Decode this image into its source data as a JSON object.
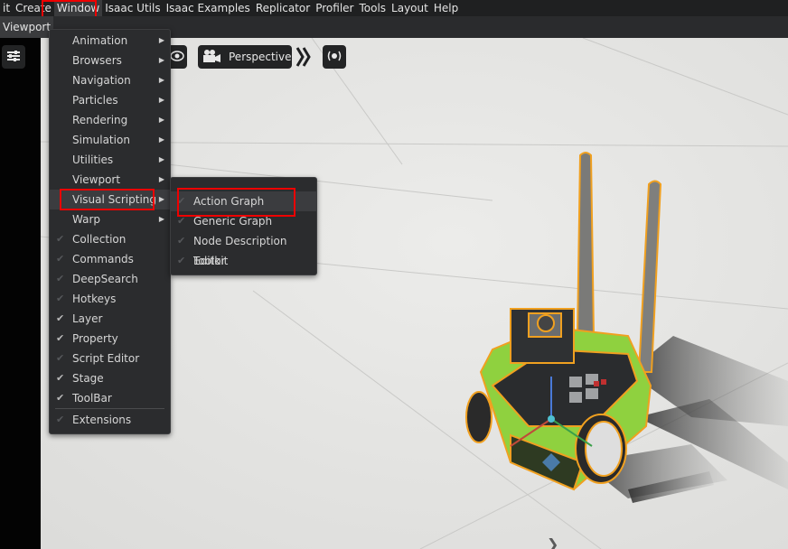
{
  "menubar": {
    "items": [
      "it",
      "Create",
      "Window",
      "Isaac Utils",
      "Isaac Examples",
      "Replicator",
      "Profiler",
      "Tools",
      "Layout",
      "Help"
    ]
  },
  "tabs": {
    "viewport": "Viewport"
  },
  "viewport_toolbar": {
    "settings_icon": "sliders-icon",
    "camera_icon": "camera-icon",
    "camera_label": "Perspective",
    "eye_icon": "eye-icon",
    "render_icon": "broadcast-icon",
    "expand_icon": "double-chevron-icon"
  },
  "window_menu": {
    "items": [
      {
        "label": "Animation",
        "submenu": true
      },
      {
        "label": "Browsers",
        "submenu": true
      },
      {
        "label": "Navigation",
        "submenu": true
      },
      {
        "label": "Particles",
        "submenu": true
      },
      {
        "label": "Rendering",
        "submenu": true
      },
      {
        "label": "Simulation",
        "submenu": true
      },
      {
        "label": "Utilities",
        "submenu": true
      },
      {
        "label": "Viewport",
        "submenu": true
      },
      {
        "label": "Visual Scripting",
        "submenu": true
      },
      {
        "label": "Warp",
        "submenu": true
      },
      {
        "label": "Collection",
        "checked": false
      },
      {
        "label": "Commands",
        "checked": false
      },
      {
        "label": "DeepSearch",
        "checked": false
      },
      {
        "label": "Hotkeys",
        "checked": false
      },
      {
        "label": "Layer",
        "checked": true
      },
      {
        "label": "Property",
        "checked": true
      },
      {
        "label": "Script Editor",
        "checked": false
      },
      {
        "label": "Stage",
        "checked": true
      },
      {
        "label": "ToolBar",
        "checked": true
      },
      {
        "label": "Extensions",
        "checked": false
      }
    ]
  },
  "visual_scripting_submenu": {
    "items": [
      {
        "label": "Action Graph",
        "checked": false
      },
      {
        "label": "Generic Graph",
        "checked": false
      },
      {
        "label": "Node Description Editor",
        "checked": false
      },
      {
        "label": "Toolkit",
        "checked": false
      }
    ]
  },
  "colors": {
    "selection_outline": "#f0a020",
    "robot_chassis": "#8fd13f",
    "highlight": "#e00000"
  }
}
